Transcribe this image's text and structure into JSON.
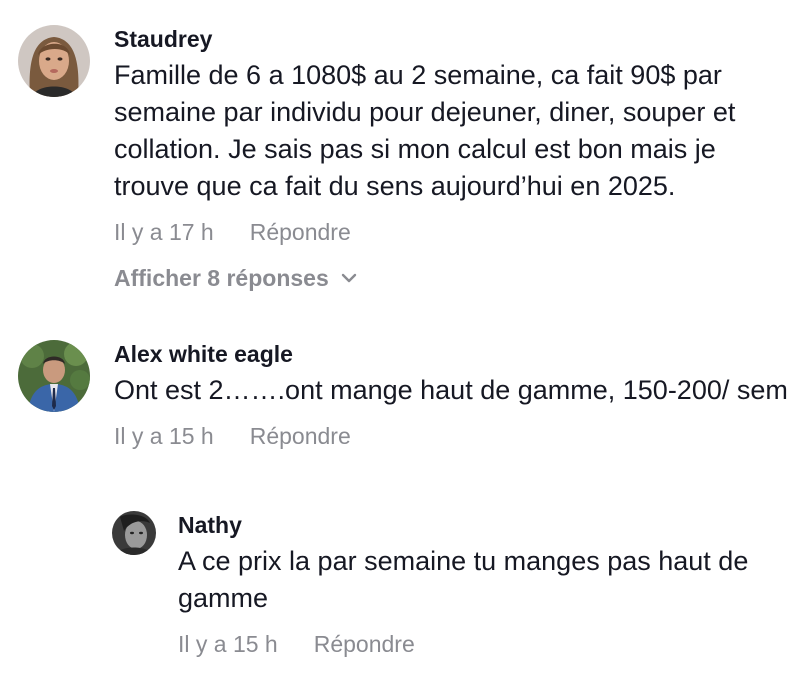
{
  "comments": [
    {
      "username": "Staudrey",
      "text": "Famille de 6 a 1080$ au 2 semaine, ca fait 90$ par semaine par individu pour dejeuner, diner, souper et collation. Je sais pas si mon calcul est bon mais je trouve que ca fait du sens aujourd’hui en 2025.",
      "time": "Il y a 17 h",
      "reply_label": "Répondre",
      "show_replies": "Afficher 8 réponses"
    },
    {
      "username": "Alex white eagle",
      "text": "Ont est 2…….ont mange haut de gamme, 150-200/ sem",
      "time": "Il y a 15 h",
      "reply_label": "Répondre"
    },
    {
      "username": "Nathy",
      "text": "A ce prix la par semaine tu manges pas haut de gamme",
      "time": "Il y a 15 h",
      "reply_label": "Répondre"
    }
  ],
  "icons": {
    "show_replies": "chevron-down-icon"
  },
  "colors": {
    "text": "#161823",
    "secondary": "#8a8b91",
    "background": "#ffffff"
  }
}
